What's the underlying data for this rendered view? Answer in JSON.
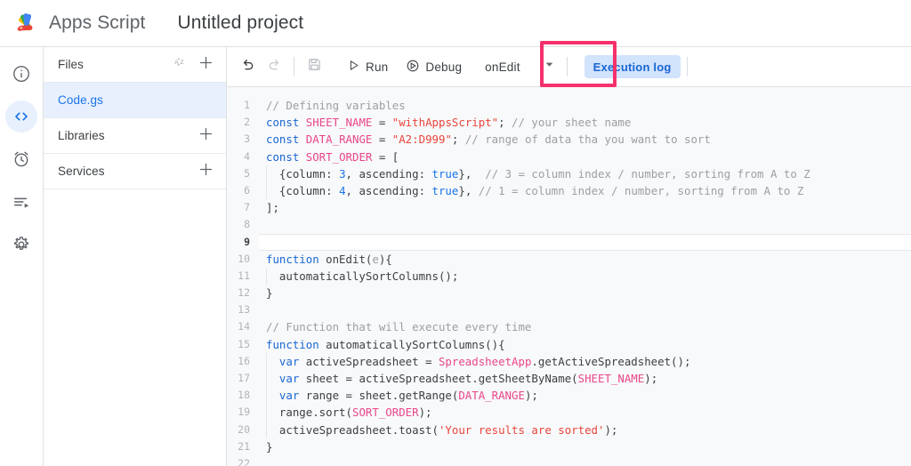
{
  "header": {
    "logo_icon": "apps-script-logo",
    "brand": "Apps Script",
    "project_title": "Untitled project"
  },
  "rail": {
    "items": [
      {
        "icon": "info-icon",
        "name": "overview",
        "active": false
      },
      {
        "icon": "code-icon",
        "name": "editor",
        "active": true
      },
      {
        "icon": "alarm-clock-icon",
        "name": "triggers",
        "active": false
      },
      {
        "icon": "executions-icon",
        "name": "executions",
        "active": false
      },
      {
        "icon": "gear-icon",
        "name": "project-settings",
        "active": false
      }
    ]
  },
  "files_panel": {
    "files_header": "Files",
    "sort_icon": "sort-az-icon",
    "add_file_icon": "plus-icon",
    "files": [
      {
        "name": "Code.gs",
        "selected": true
      }
    ],
    "libraries_header": "Libraries",
    "add_library_icon": "plus-icon",
    "services_header": "Services",
    "add_service_icon": "plus-icon"
  },
  "toolbar": {
    "undo_icon": "undo-icon",
    "redo_icon": "redo-icon",
    "save_icon": "save-icon",
    "run_label": "Run",
    "run_icon": "play-icon",
    "debug_label": "Debug",
    "debug_icon": "debug-icon",
    "function_selected": "onEdit",
    "dropdown_icon": "chevron-down-icon",
    "execution_log_label": "Execution log",
    "annotation_color": "#f5316b",
    "annotation_target": "Run"
  },
  "editor": {
    "file": "Code.gs",
    "active_line": 9,
    "total_lines": 22,
    "lines": [
      {
        "n": "1",
        "tokens": [
          {
            "t": "// Defining variables",
            "c": "t-com"
          }
        ]
      },
      {
        "n": "2",
        "tokens": [
          {
            "t": "const ",
            "c": "t-kw"
          },
          {
            "t": "SHEET_NAME",
            "c": "t-const"
          },
          {
            "t": " = ",
            "c": "t-plain"
          },
          {
            "t": "\"withAppsScript\"",
            "c": "t-str"
          },
          {
            "t": "; ",
            "c": "t-plain"
          },
          {
            "t": "// your sheet name",
            "c": "t-com"
          }
        ]
      },
      {
        "n": "3",
        "tokens": [
          {
            "t": "const ",
            "c": "t-kw"
          },
          {
            "t": "DATA_RANGE",
            "c": "t-const"
          },
          {
            "t": " = ",
            "c": "t-plain"
          },
          {
            "t": "\"A2:D999\"",
            "c": "t-str"
          },
          {
            "t": "; ",
            "c": "t-plain"
          },
          {
            "t": "// range of data tha you want to sort",
            "c": "t-com"
          }
        ]
      },
      {
        "n": "4",
        "tokens": [
          {
            "t": "const ",
            "c": "t-kw"
          },
          {
            "t": "SORT_ORDER",
            "c": "t-const"
          },
          {
            "t": " = [",
            "c": "t-plain"
          }
        ]
      },
      {
        "n": "5",
        "tokens": [
          {
            "t": "  {column: ",
            "c": "t-plain"
          },
          {
            "t": "3",
            "c": "t-num"
          },
          {
            "t": ", ascending: ",
            "c": "t-plain"
          },
          {
            "t": "true",
            "c": "t-bool"
          },
          {
            "t": "},  ",
            "c": "t-plain"
          },
          {
            "t": "// 3 = column index / number, sorting from A to Z",
            "c": "t-com"
          }
        ]
      },
      {
        "n": "6",
        "tokens": [
          {
            "t": "  {column: ",
            "c": "t-plain"
          },
          {
            "t": "4",
            "c": "t-num"
          },
          {
            "t": ", ascending: ",
            "c": "t-plain"
          },
          {
            "t": "true",
            "c": "t-bool"
          },
          {
            "t": "}, ",
            "c": "t-plain"
          },
          {
            "t": "// 1 = column index / number, sorting from A to Z",
            "c": "t-com"
          }
        ]
      },
      {
        "n": "7",
        "tokens": [
          {
            "t": "];",
            "c": "t-plain"
          }
        ]
      },
      {
        "n": "8",
        "tokens": []
      },
      {
        "n": "9",
        "tokens": []
      },
      {
        "n": "10",
        "tokens": [
          {
            "t": "function ",
            "c": "t-kw"
          },
          {
            "t": "onEdit",
            "c": "t-plain"
          },
          {
            "t": "(",
            "c": "t-plain"
          },
          {
            "t": "e",
            "c": "t-param"
          },
          {
            "t": "){",
            "c": "t-plain"
          }
        ]
      },
      {
        "n": "11",
        "tokens": [
          {
            "t": "  automaticallySortColumns();",
            "c": "t-plain"
          }
        ]
      },
      {
        "n": "12",
        "tokens": [
          {
            "t": "}",
            "c": "t-plain"
          }
        ]
      },
      {
        "n": "13",
        "tokens": []
      },
      {
        "n": "14",
        "tokens": [
          {
            "t": "// Function that will execute every time",
            "c": "t-com"
          }
        ]
      },
      {
        "n": "15",
        "tokens": [
          {
            "t": "function ",
            "c": "t-kw"
          },
          {
            "t": "automaticallySortColumns(){",
            "c": "t-plain"
          }
        ]
      },
      {
        "n": "16",
        "tokens": [
          {
            "t": "  ",
            "c": "t-plain"
          },
          {
            "t": "var ",
            "c": "t-kw"
          },
          {
            "t": "activeSpreadsheet = ",
            "c": "t-plain"
          },
          {
            "t": "SpreadsheetApp",
            "c": "t-cls"
          },
          {
            "t": ".getActiveSpreadsheet();",
            "c": "t-plain"
          }
        ]
      },
      {
        "n": "17",
        "tokens": [
          {
            "t": "  ",
            "c": "t-plain"
          },
          {
            "t": "var ",
            "c": "t-kw"
          },
          {
            "t": "sheet = activeSpreadsheet.getSheetByName(",
            "c": "t-plain"
          },
          {
            "t": "SHEET_NAME",
            "c": "t-const"
          },
          {
            "t": ");",
            "c": "t-plain"
          }
        ]
      },
      {
        "n": "18",
        "tokens": [
          {
            "t": "  ",
            "c": "t-plain"
          },
          {
            "t": "var ",
            "c": "t-kw"
          },
          {
            "t": "range = sheet.getRange(",
            "c": "t-plain"
          },
          {
            "t": "DATA_RANGE",
            "c": "t-const"
          },
          {
            "t": ");",
            "c": "t-plain"
          }
        ]
      },
      {
        "n": "19",
        "tokens": [
          {
            "t": "  range.sort(",
            "c": "t-plain"
          },
          {
            "t": "SORT_ORDER",
            "c": "t-const"
          },
          {
            "t": ");",
            "c": "t-plain"
          }
        ]
      },
      {
        "n": "20",
        "tokens": [
          {
            "t": "  activeSpreadsheet.toast(",
            "c": "t-plain"
          },
          {
            "t": "'Your results are sorted'",
            "c": "t-str"
          },
          {
            "t": ");",
            "c": "t-plain"
          }
        ]
      },
      {
        "n": "21",
        "tokens": [
          {
            "t": "}",
            "c": "t-plain"
          }
        ]
      },
      {
        "n": "22",
        "tokens": []
      }
    ]
  }
}
